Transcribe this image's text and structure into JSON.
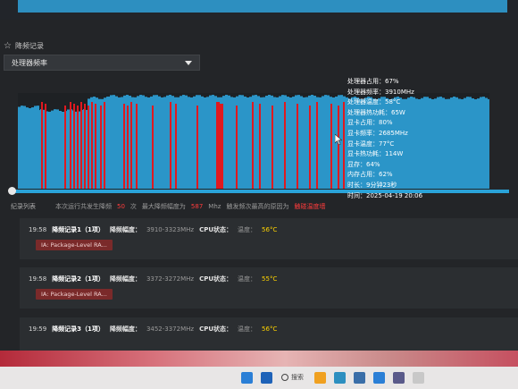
{
  "section": {
    "title": "降频记录",
    "icon": "star-icon"
  },
  "dropdown": {
    "selected": "处理器频率"
  },
  "tooltip": {
    "lines": [
      "处理器占用：67%",
      "处理器频率：3910MHz",
      "处理器温度：58°C",
      "处理器热功耗：65W",
      "显卡占用：80%",
      "显卡频率：2685MHz",
      "显卡温度：77°C",
      "显卡热功耗：114W",
      "显存：64%",
      "内存占用：62%",
      "时长：9分钟23秒",
      "时间：2025-04-19 20:06"
    ]
  },
  "summary": {
    "list_title": "纪录列表",
    "text1": "本次运行共发生降频",
    "count": "50",
    "unit_times": "次",
    "text2": "最大降频幅度为",
    "max_drop": "587",
    "unit_mhz": "Mhz",
    "text3": "触发频次最高的原因为",
    "reason": "触碰温度墙"
  },
  "records": [
    {
      "time": "19:58",
      "title": "降频记录1（1项）",
      "amp_label": "降频幅度：",
      "amp": "3910-3323MHz",
      "cpu_label": "CPU状态：",
      "temp_label": "温度：",
      "temp": "56°C",
      "tag": "IA: Package-Level RA..."
    },
    {
      "time": "19:58",
      "title": "降频记录2（1项）",
      "amp_label": "降频幅度：",
      "amp": "3372-3272MHz",
      "cpu_label": "CPU状态：",
      "temp_label": "温度：",
      "temp": "55°C",
      "tag": "IA: Package-Level RA..."
    },
    {
      "time": "19:59",
      "title": "降频记录3（1项）",
      "amp_label": "降频幅度：",
      "amp": "3452-3372MHz",
      "cpu_label": "CPU状态：",
      "temp_label": "温度：",
      "temp": "56°C",
      "tag": ""
    }
  ],
  "taskbar": {
    "search_label": "搜索"
  },
  "colors": {
    "bar": "#2b95c8",
    "throttle": "#e0191f",
    "accent": "#2aa3d8",
    "temp": "#ffd400"
  }
}
